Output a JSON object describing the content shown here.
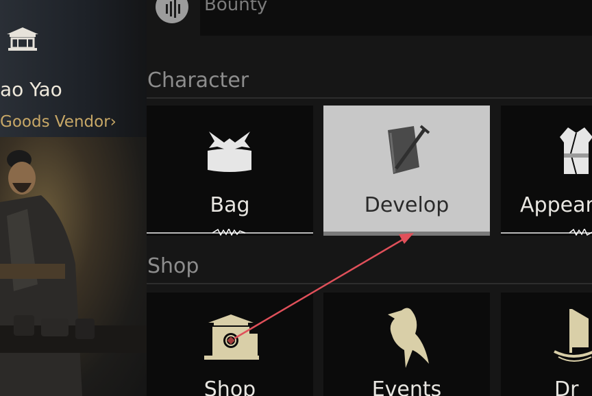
{
  "npc": {
    "name": "ao Yao",
    "role": "Goods Vendor",
    "icon": "pagoda-shop-icon"
  },
  "top_row": {
    "label": "Bounty",
    "icon": "bounty-icon"
  },
  "sections": {
    "character": {
      "title": "Character",
      "tiles": [
        {
          "label": "Bag",
          "icon": "bag-icon",
          "selected": false
        },
        {
          "label": "Develop",
          "icon": "develop-book-sword-icon",
          "selected": true
        },
        {
          "label": "Appear",
          "icon": "appearance-robe-icon",
          "selected": false
        }
      ]
    },
    "shop": {
      "title": "Shop",
      "tiles": [
        {
          "label": "Shop",
          "icon": "shop-pavilion-icon",
          "selected": false
        },
        {
          "label": "Events",
          "icon": "events-bird-icon",
          "selected": false
        },
        {
          "label": "Dr",
          "icon": "ship-icon",
          "selected": false
        }
      ]
    }
  },
  "annotation": {
    "type": "arrow",
    "color": "#e0505a"
  },
  "colors": {
    "accent_gold": "#c8a867",
    "tile_bg": "#0b0b0b",
    "tile_selected_bg": "#c8c8c8",
    "section_title": "#8d8d8d"
  }
}
